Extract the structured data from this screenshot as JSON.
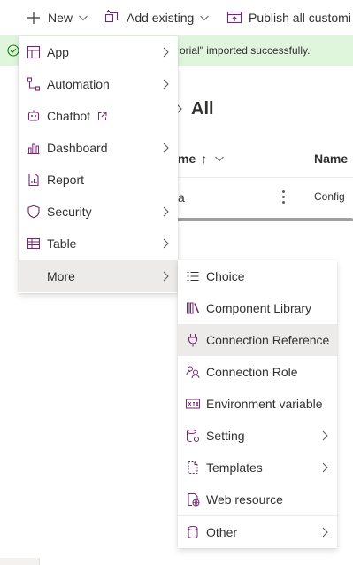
{
  "commandbar": {
    "new_label": "New",
    "add_existing_label": "Add existing",
    "publish_label": "Publish all customi"
  },
  "banner": {
    "message": "orial\" imported successfully."
  },
  "page": {
    "breadcrumb_current": "All"
  },
  "table": {
    "header_name": "me",
    "header_name_sort": "↑",
    "header_name2": "Name",
    "row_name_fragment": "a",
    "row_type_fragment": "Config"
  },
  "new_menu": {
    "items": [
      {
        "label": "App",
        "icon": "app-icon",
        "submenu": true
      },
      {
        "label": "Automation",
        "icon": "flow-icon",
        "submenu": true
      },
      {
        "label": "Chatbot",
        "icon": "bot-icon",
        "submenu": false,
        "external": true
      },
      {
        "label": "Dashboard",
        "icon": "dashboard-icon",
        "submenu": true
      },
      {
        "label": "Report",
        "icon": "report-icon",
        "submenu": false
      },
      {
        "label": "Security",
        "icon": "shield-icon",
        "submenu": true
      },
      {
        "label": "Table",
        "icon": "table-icon",
        "submenu": true
      },
      {
        "label": "More",
        "icon": "",
        "submenu": true,
        "highlighted": true
      }
    ]
  },
  "more_menu": {
    "items": [
      {
        "label": "Choice",
        "icon": "list-icon",
        "submenu": false
      },
      {
        "label": "Component Library",
        "icon": "library-icon",
        "submenu": false
      },
      {
        "label": "Connection Reference",
        "icon": "plug-icon",
        "submenu": false,
        "highlighted": true
      },
      {
        "label": "Connection Role",
        "icon": "people-icon",
        "submenu": false
      },
      {
        "label": "Environment variable",
        "icon": "variable-icon",
        "submenu": false
      },
      {
        "label": "Setting",
        "icon": "settings-db-icon",
        "submenu": true
      },
      {
        "label": "Templates",
        "icon": "template-icon",
        "submenu": true
      },
      {
        "label": "Web resource",
        "icon": "globe-page-icon",
        "submenu": false
      },
      {
        "label": "Other",
        "icon": "database-icon",
        "submenu": true
      }
    ]
  },
  "colors": {
    "accent": "#742774",
    "success_bg": "#dff6dd",
    "success_icon": "#107c10",
    "hover_bg": "#edebe9"
  }
}
